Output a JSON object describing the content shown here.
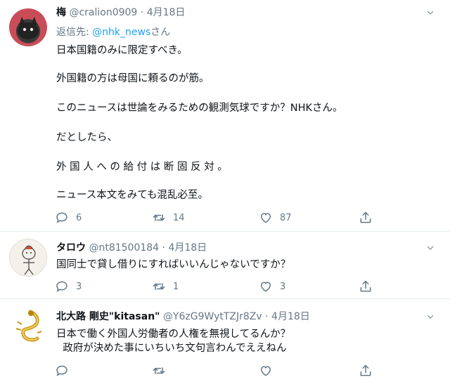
{
  "tweets": [
    {
      "name": "梅",
      "handle": "@cralion0909",
      "sep": "·",
      "date": "4月18日",
      "reply_prefix": "返信先: ",
      "reply_link": "@nhk_news",
      "reply_suffix": "さん",
      "lines": [
        "日本国籍のみに限定すべき。",
        "外国籍の方は母国に頼るのが筋。",
        "このニュースは世論をみるための観測気球ですか？NHKさん。",
        "だとしたら、",
        "外 国 人 へ の 給 付 は 断 固 反 対 。",
        "ニュース本文をみても混乱必至。"
      ],
      "replies": "6",
      "retweets": "14",
      "likes": "87"
    },
    {
      "name": "タロウ",
      "handle": "@nt81500184",
      "sep": "·",
      "date": "4月18日",
      "lines": [
        "国同士で貸し借りにすればいいんじゃないですか？"
      ],
      "replies": "3",
      "retweets": "1",
      "likes": "3"
    },
    {
      "name": "北大路 剛史\"kitasan\"",
      "handle": "@Y6zG9WytTZJr8Zv",
      "sep": "·",
      "date": "4月18日",
      "lines": [
        "日本で働く外国人労働者の人権を無視してるんか？",
        "  政府が決めた事にいちいち文句言わんでええねん"
      ],
      "replies": "",
      "retweets": "",
      "likes": ""
    }
  ],
  "colors": {
    "accent": "#1da1f2",
    "muted": "#657786",
    "text": "#0f1419"
  },
  "icons": [
    "reply-icon",
    "retweet-icon",
    "like-icon",
    "share-icon",
    "chevron-down-icon"
  ]
}
